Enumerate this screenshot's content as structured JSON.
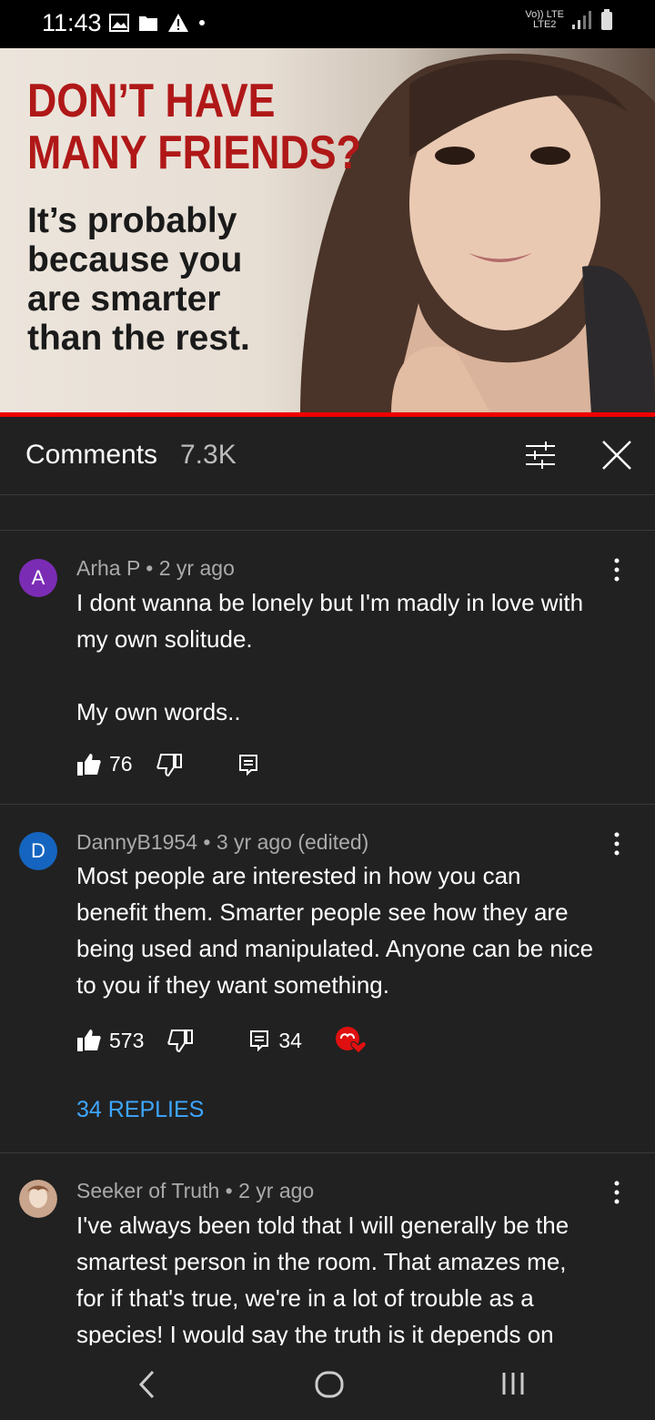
{
  "status": {
    "time": "11:43",
    "carrier_top": "Vo)) LTE",
    "carrier_bottom": "LTE2"
  },
  "thumbnail": {
    "headline_line1": "DON’T HAVE",
    "headline_line2": "MANY FRIENDS?",
    "sub_line1": "It’s probably",
    "sub_line2": "because you",
    "sub_line3": "are smarter",
    "sub_line4": "than the rest."
  },
  "header": {
    "title": "Comments",
    "count": "7.3K"
  },
  "comments": [
    {
      "avatar_letter": "A",
      "avatar_color": "#7b2cb5",
      "author": "Arha P",
      "time": "2 yr ago",
      "body_line1": "I dont wanna be lonely but I'm madly in love with",
      "body_line2": "my own solitude.",
      "body_line3": "My own words..",
      "likes": "76"
    },
    {
      "avatar_letter": "D",
      "avatar_color": "#1565c0",
      "author": "DannyB1954",
      "time": "3 yr ago (edited)",
      "body_line1": "Most people are interested in how you can",
      "body_line2": "benefit them. Smarter people see how they are",
      "body_line3": "being used and manipulated. Anyone can be nice",
      "body_line4": "to you if they want something.",
      "likes": "573",
      "reply_count": "34",
      "replies_link": "34 REPLIES"
    },
    {
      "author": "Seeker of Truth",
      "time": "2 yr ago",
      "body_line1": "I've always been told that I will generally be the",
      "body_line2": "smartest person in the room.  That amazes me,",
      "body_line3": "for if that's true, we're in a lot of trouble as a",
      "body_line4": "species!  I would say the truth is it depends on"
    }
  ],
  "colors": {
    "accent_link": "#3ea6ff",
    "progress": "#ee0000",
    "background": "#212121"
  }
}
